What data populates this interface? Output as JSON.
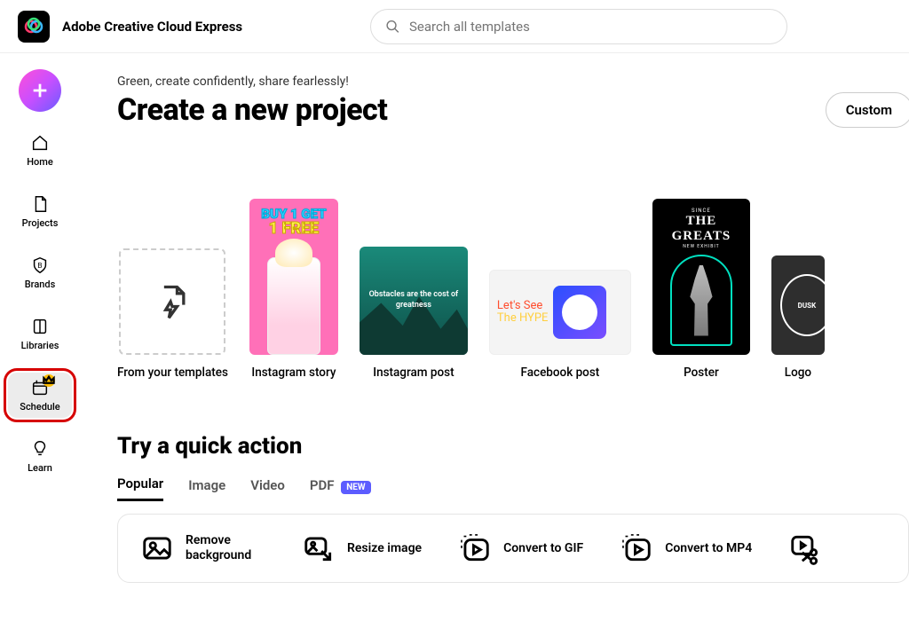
{
  "header": {
    "app_title": "Adobe Creative Cloud Express",
    "search_placeholder": "Search all templates"
  },
  "sidebar": {
    "items": [
      {
        "key": "home",
        "label": "Home"
      },
      {
        "key": "projects",
        "label": "Projects"
      },
      {
        "key": "brands",
        "label": "Brands"
      },
      {
        "key": "libraries",
        "label": "Libraries"
      },
      {
        "key": "schedule",
        "label": "Schedule",
        "premium": true,
        "highlighted": true
      },
      {
        "key": "learn",
        "label": "Learn"
      }
    ]
  },
  "main": {
    "tagline": "Green, create confidently, share fearlessly!",
    "title": "Create a new project",
    "custom_button": "Custom",
    "templates": [
      {
        "key": "from-templates",
        "label": "From your templates"
      },
      {
        "key": "ig-story",
        "label": "Instagram story",
        "art": {
          "line1": "BUY 1 GET",
          "line2": "1 FREE"
        }
      },
      {
        "key": "ig-post",
        "label": "Instagram post",
        "art": {
          "text": "Obstacles are the cost of greatness"
        }
      },
      {
        "key": "fb-post",
        "label": "Facebook post",
        "art": {
          "l1": "Let's See",
          "l2": "The HYPE"
        }
      },
      {
        "key": "poster",
        "label": "Poster",
        "art": {
          "top": "SINCE",
          "title1": "THE",
          "title2": "GREATS",
          "sub": "NEW EXHIBIT"
        }
      },
      {
        "key": "logo",
        "label": "Logo",
        "art": {
          "text": "DUSK"
        }
      }
    ],
    "quick_title": "Try a quick action",
    "tabs": [
      {
        "key": "popular",
        "label": "Popular",
        "active": true
      },
      {
        "key": "image",
        "label": "Image"
      },
      {
        "key": "video",
        "label": "Video"
      },
      {
        "key": "pdf",
        "label": "PDF",
        "badge": "NEW"
      }
    ],
    "actions": [
      {
        "key": "remove-bg",
        "label": "Remove background"
      },
      {
        "key": "resize",
        "label": "Resize image"
      },
      {
        "key": "to-gif",
        "label": "Convert to GIF"
      },
      {
        "key": "to-mp4",
        "label": "Convert to MP4"
      },
      {
        "key": "trim",
        "label": ""
      }
    ]
  }
}
